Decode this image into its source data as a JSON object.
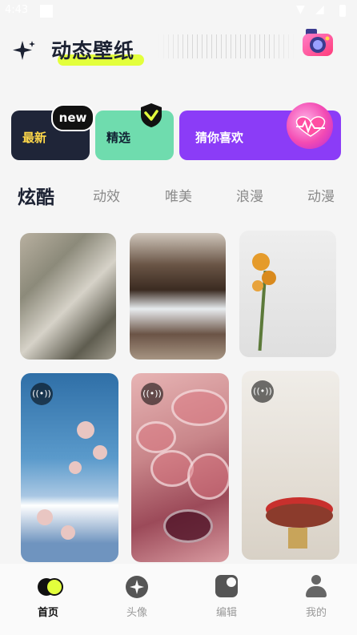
{
  "status": {
    "time": "4:43"
  },
  "header": {
    "title": "动态壁纸"
  },
  "categories": [
    {
      "label": "最新",
      "badge": "new"
    },
    {
      "label": "精选"
    },
    {
      "label": "猜你喜欢"
    }
  ],
  "tabs": [
    "炫酷",
    "动效",
    "唯美",
    "浪漫",
    "动漫"
  ],
  "nav": [
    {
      "label": "首页"
    },
    {
      "label": "头像"
    },
    {
      "label": "编辑"
    },
    {
      "label": "我的"
    }
  ],
  "colors": {
    "accent": "#e3ff3c",
    "purple": "#8b3cf7",
    "mint": "#6fdcae",
    "dark": "#1f2538"
  }
}
